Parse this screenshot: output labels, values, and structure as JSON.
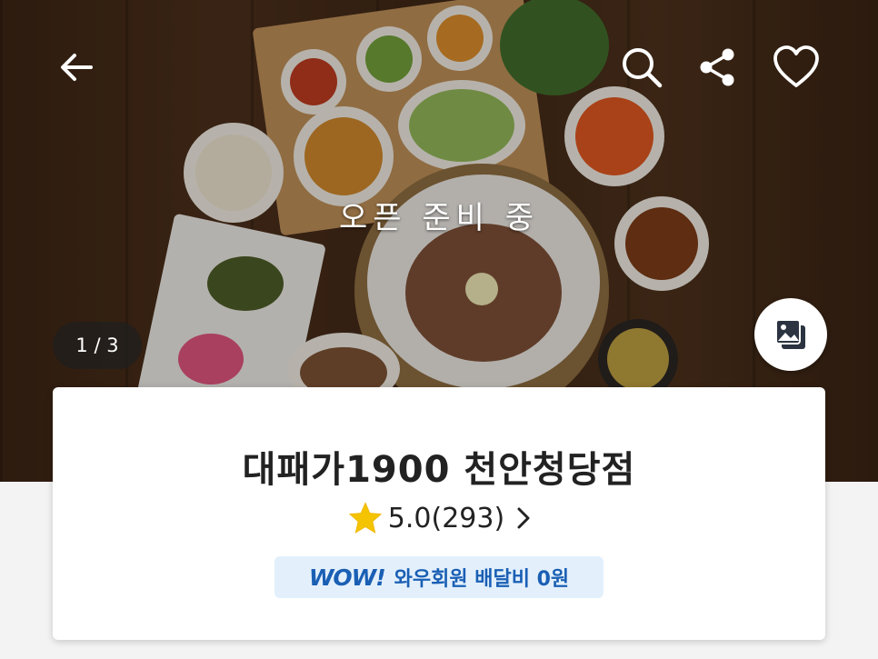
{
  "header": {
    "back_icon": "arrow-left-icon",
    "search_icon": "search-icon",
    "share_icon": "share-icon",
    "favorite_icon": "heart-outline-icon"
  },
  "hero": {
    "status_text": "오픈 준비 중",
    "image_counter": "1 / 3",
    "gallery_icon": "photo-gallery-icon"
  },
  "store": {
    "name": "대패가1900 천안청당점",
    "rating_value": "5.0",
    "review_count": "(293)",
    "rating_chevron": "chevron-right-icon",
    "wow_logo": "WOW!",
    "wow_benefit": "와우회원 배달비 0원"
  },
  "colors": {
    "wow_blue": "#1a5fb4",
    "wow_badge_bg": "#e3f0fc",
    "star_yellow": "#f5c400"
  }
}
